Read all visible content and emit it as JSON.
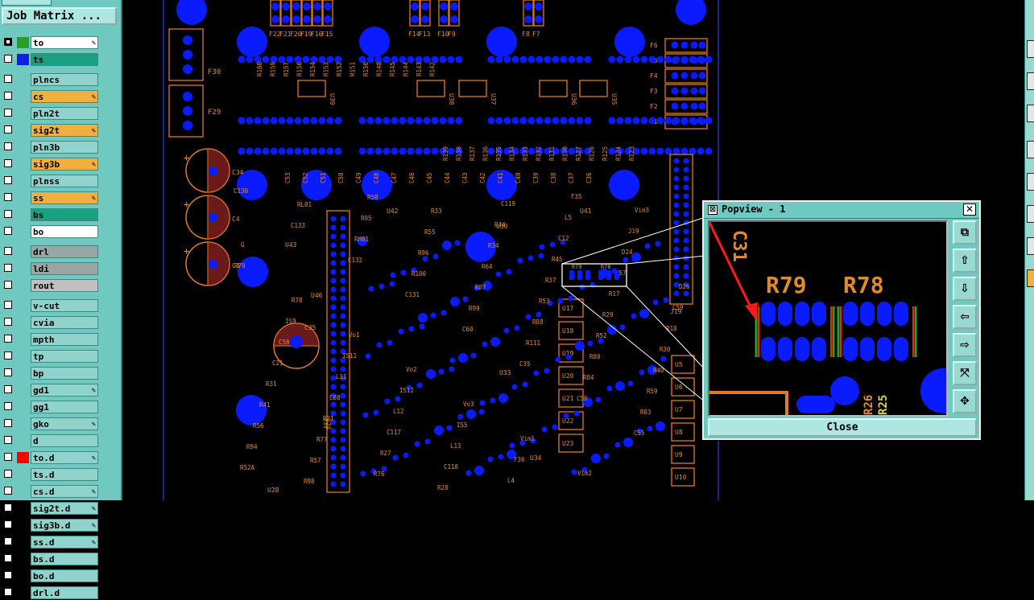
{
  "job_matrix": {
    "label": "Job Matrix ..."
  },
  "colors": {
    "panel_bg": "#6fc9c0",
    "pad_blue": "#0a1cff",
    "outline_orange": "#e07a1e",
    "silk_orange": "#e08a2a",
    "annotation_red": "#ff1a1a",
    "board_edge_blue": "#2030c0"
  },
  "layers": [
    {
      "name": "to",
      "bg": "#ffffff",
      "swatch": "#28a028",
      "edit": true,
      "checked": true
    },
    {
      "name": "ts",
      "bg": "#18a080",
      "swatch": "#1020e0",
      "edit": false,
      "checked": false
    },
    {
      "name": "plncs",
      "bg": "#8fd3cc",
      "swatch": "",
      "edit": false,
      "checked": false
    },
    {
      "name": "cs",
      "bg": "#f0b040",
      "swatch": "",
      "edit": true,
      "checked": false
    },
    {
      "name": "pln2t",
      "bg": "#8fd3cc",
      "swatch": "",
      "edit": false,
      "checked": false
    },
    {
      "name": "sig2t",
      "bg": "#f0b040",
      "swatch": "",
      "edit": true,
      "checked": false
    },
    {
      "name": "pln3b",
      "bg": "#8fd3cc",
      "swatch": "",
      "edit": false,
      "checked": false
    },
    {
      "name": "sig3b",
      "bg": "#f0b040",
      "swatch": "",
      "edit": true,
      "checked": false
    },
    {
      "name": "plnss",
      "bg": "#8fd3cc",
      "swatch": "",
      "edit": false,
      "checked": false
    },
    {
      "name": "ss",
      "bg": "#f0b040",
      "swatch": "",
      "edit": true,
      "checked": false
    },
    {
      "name": "bs",
      "bg": "#18a080",
      "swatch": "",
      "edit": false,
      "checked": false
    },
    {
      "name": "bo",
      "bg": "#ffffff",
      "swatch": "",
      "edit": false,
      "checked": false
    },
    {
      "name": "drl",
      "bg": "#9aa6a4",
      "swatch": "",
      "edit": false,
      "checked": false
    },
    {
      "name": "ldi",
      "bg": "#9aa6a4",
      "swatch": "",
      "edit": false,
      "checked": false
    },
    {
      "name": "rout",
      "bg": "#c0c0c0",
      "swatch": "",
      "edit": false,
      "checked": false
    },
    {
      "name": "v-cut",
      "bg": "#8fd3cc",
      "swatch": "",
      "edit": false,
      "checked": false
    },
    {
      "name": "cvia",
      "bg": "#8fd3cc",
      "swatch": "",
      "edit": false,
      "checked": false
    },
    {
      "name": "mpth",
      "bg": "#8fd3cc",
      "swatch": "",
      "edit": false,
      "checked": false
    },
    {
      "name": "tp",
      "bg": "#8fd3cc",
      "swatch": "",
      "edit": false,
      "checked": false
    },
    {
      "name": "bp",
      "bg": "#8fd3cc",
      "swatch": "",
      "edit": false,
      "checked": false
    },
    {
      "name": "gd1",
      "bg": "#8fd3cc",
      "swatch": "",
      "edit": true,
      "checked": false
    },
    {
      "name": "gg1",
      "bg": "#8fd3cc",
      "swatch": "",
      "edit": false,
      "checked": false
    },
    {
      "name": "gko",
      "bg": "#8fd3cc",
      "swatch": "",
      "edit": true,
      "checked": false
    },
    {
      "name": "d",
      "bg": "#8fd3cc",
      "swatch": "",
      "edit": false,
      "checked": false
    },
    {
      "name": "to.d",
      "bg": "#8fd3cc",
      "swatch": "#ff0000",
      "edit": true,
      "checked": false
    },
    {
      "name": "ts.d",
      "bg": "#8fd3cc",
      "swatch": "",
      "edit": false,
      "checked": false
    },
    {
      "name": "cs.d",
      "bg": "#8fd3cc",
      "swatch": "",
      "edit": true,
      "checked": false
    },
    {
      "name": "sig2t.d",
      "bg": "#8fd3cc",
      "swatch": "",
      "edit": true,
      "checked": false
    },
    {
      "name": "sig3b.d",
      "bg": "#8fd3cc",
      "swatch": "",
      "edit": true,
      "checked": false
    },
    {
      "name": "ss.d",
      "bg": "#8fd3cc",
      "swatch": "",
      "edit": true,
      "checked": false
    },
    {
      "name": "bs.d",
      "bg": "#8fd3cc",
      "swatch": "",
      "edit": false,
      "checked": false
    },
    {
      "name": "bo.d",
      "bg": "#8fd3cc",
      "swatch": "",
      "edit": false,
      "checked": false
    },
    {
      "name": "drl.d",
      "bg": "#8fd3cc",
      "swatch": "",
      "edit": false,
      "checked": false
    }
  ],
  "board_labels": {
    "fuses_top": [
      "F22",
      "F21",
      "F20",
      "F19",
      "F16",
      "F15",
      "F14",
      "F13",
      "F10",
      "F9",
      "F8",
      "F7"
    ],
    "fuses_right": [
      "F6",
      "F5",
      "F4",
      "F3",
      "F2",
      "F1"
    ],
    "fuses_left": [
      "F30",
      "F29"
    ],
    "caps_left": [
      "C34",
      "C4",
      "C3"
    ],
    "chips": [
      "U39",
      "U38",
      "U37",
      "U36",
      "U35",
      "U42",
      "U41",
      "U43",
      "U46",
      "U30",
      "U33",
      "U34",
      "U28",
      "U24"
    ],
    "misc": [
      "C130",
      "C133",
      "C132",
      "C131",
      "C60",
      "C35",
      "C56",
      "C55",
      "R52A",
      "RL01",
      "RH01",
      "R100",
      "R99",
      "R111",
      "R84",
      "R83",
      "R94",
      "R98",
      "R95",
      "R96",
      "R87",
      "R88",
      "R80",
      "R59",
      "R56",
      "R57",
      "R58",
      "R55",
      "R64",
      "R53",
      "R52",
      "R40",
      "R41",
      "R77",
      "R76",
      "R33",
      "R34",
      "R37",
      "R29",
      "R30",
      "R31",
      "R21",
      "R27",
      "R28",
      "R44",
      "R45",
      "R17",
      "R18",
      "C21",
      "C88",
      "C117",
      "C118",
      "C119",
      "C12",
      "C57",
      "C59",
      "C58",
      "L11",
      "L12",
      "L13",
      "L4",
      "L5",
      "D24",
      "D26",
      "IS9",
      "IS11",
      "IS12",
      "IS5",
      "F36",
      "F35",
      "J19",
      "R79",
      "R78",
      "Vo1",
      "Vo2",
      "Vo3",
      "Vim1",
      "Vim2",
      "Vim3",
      "G"
    ],
    "regulators": [
      "U17",
      "U18",
      "U19",
      "U20",
      "U21",
      "U22",
      "U23"
    ],
    "right_stack": [
      "U5",
      "U6",
      "U7",
      "U8",
      "U9",
      "U10"
    ],
    "vertical_top": [
      "R160",
      "R159",
      "R157",
      "R156",
      "R154",
      "R153",
      "R152",
      "R151",
      "R150",
      "R148",
      "R145",
      "R144",
      "R143",
      "R142",
      "R139",
      "R138",
      "R137",
      "R136",
      "R135",
      "R134",
      "R133",
      "R132",
      "R131",
      "R130",
      "R127",
      "R126",
      "R125",
      "R124",
      "R123"
    ],
    "vertical_caps": [
      "C53",
      "C52",
      "C51",
      "C50",
      "C49",
      "C48",
      "C47",
      "C46",
      "C45",
      "C44",
      "C43",
      "C42",
      "C41",
      "C40",
      "C39",
      "C38",
      "C37",
      "C36"
    ]
  },
  "popview": {
    "title": "Popview - 1",
    "close_label": "Close",
    "zoom_labels": [
      "R79",
      "R78"
    ],
    "partial_labels": [
      "C31",
      "R26",
      "R25"
    ]
  }
}
